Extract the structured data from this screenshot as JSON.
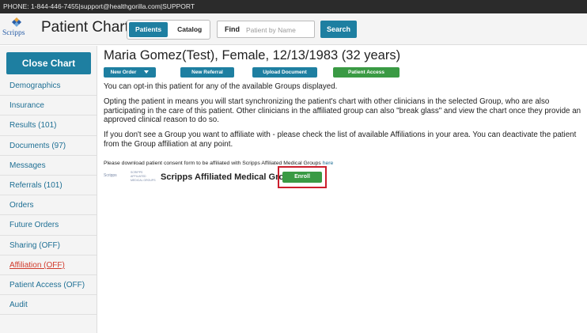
{
  "topbar": {
    "phone": "PHONE: 1-844-446-7455",
    "separator": " | ",
    "email": "support@healthgorilla.com",
    "support": "SUPPORT"
  },
  "header": {
    "logo_text": "Scripps",
    "app_title": "Patient Chart",
    "tabs": [
      {
        "label": "Patients",
        "active": true
      },
      {
        "label": "Catalog",
        "active": false
      }
    ],
    "find_label": "Find",
    "find_placeholder": "Patient by Name",
    "search_label": "Search"
  },
  "sidebar": {
    "close_chart": "Close Chart",
    "items": [
      {
        "label": "Demographics"
      },
      {
        "label": "Insurance"
      },
      {
        "label": "Results (101)"
      },
      {
        "label": "Documents (97)"
      },
      {
        "label": "Messages"
      },
      {
        "label": "Referrals (101)"
      },
      {
        "label": "Orders"
      },
      {
        "label": "Future Orders"
      },
      {
        "label": "Sharing (OFF)"
      },
      {
        "label": "Affiliation (OFF)",
        "current": true
      },
      {
        "label": "Patient Access (OFF)"
      },
      {
        "label": "Audit"
      }
    ]
  },
  "main": {
    "patient_title": "Maria Gomez(Test), Female, 12/13/1983 (32 years)",
    "actions": {
      "new_order": "New Order",
      "new_referral": "New Referral",
      "upload_document": "Upload Document",
      "patient_access": "Patient Access"
    },
    "para1": "You can opt-in this patient for any of the available Groups displayed.",
    "para2": "Opting the patient in means you will start synchronizing the patient's chart with other clinicians in the selected Group, who are also participating in the care of this patient. Other clinicians in the affiliated group can also \"break glass\" and view the chart once they provide an approved clinical reason to do so.",
    "para3": "If you don't see a Group you want to affiliate with - please check the list of available Affiliations in your area. You can deactivate the patient from the Group affiliation at any point.",
    "consent_text": "Please download patient consent form to be affiliated with Scripps Affiliated Medical Groups ",
    "consent_link": "here",
    "group": {
      "mini_logo_1": "Scripps",
      "mini_logo_2": "SCRIPPS AFFILIATED MEDICAL GROUPS",
      "name": "Scripps Affiliated Medical Groups",
      "enroll_label": "Enroll"
    }
  },
  "colors": {
    "accent_blue": "#1e7fa1",
    "accent_green": "#3a9a44",
    "highlight_red": "#cc1f2d",
    "current_nav_red": "#d13a2b",
    "topbar_bg": "#2b2b2b"
  }
}
